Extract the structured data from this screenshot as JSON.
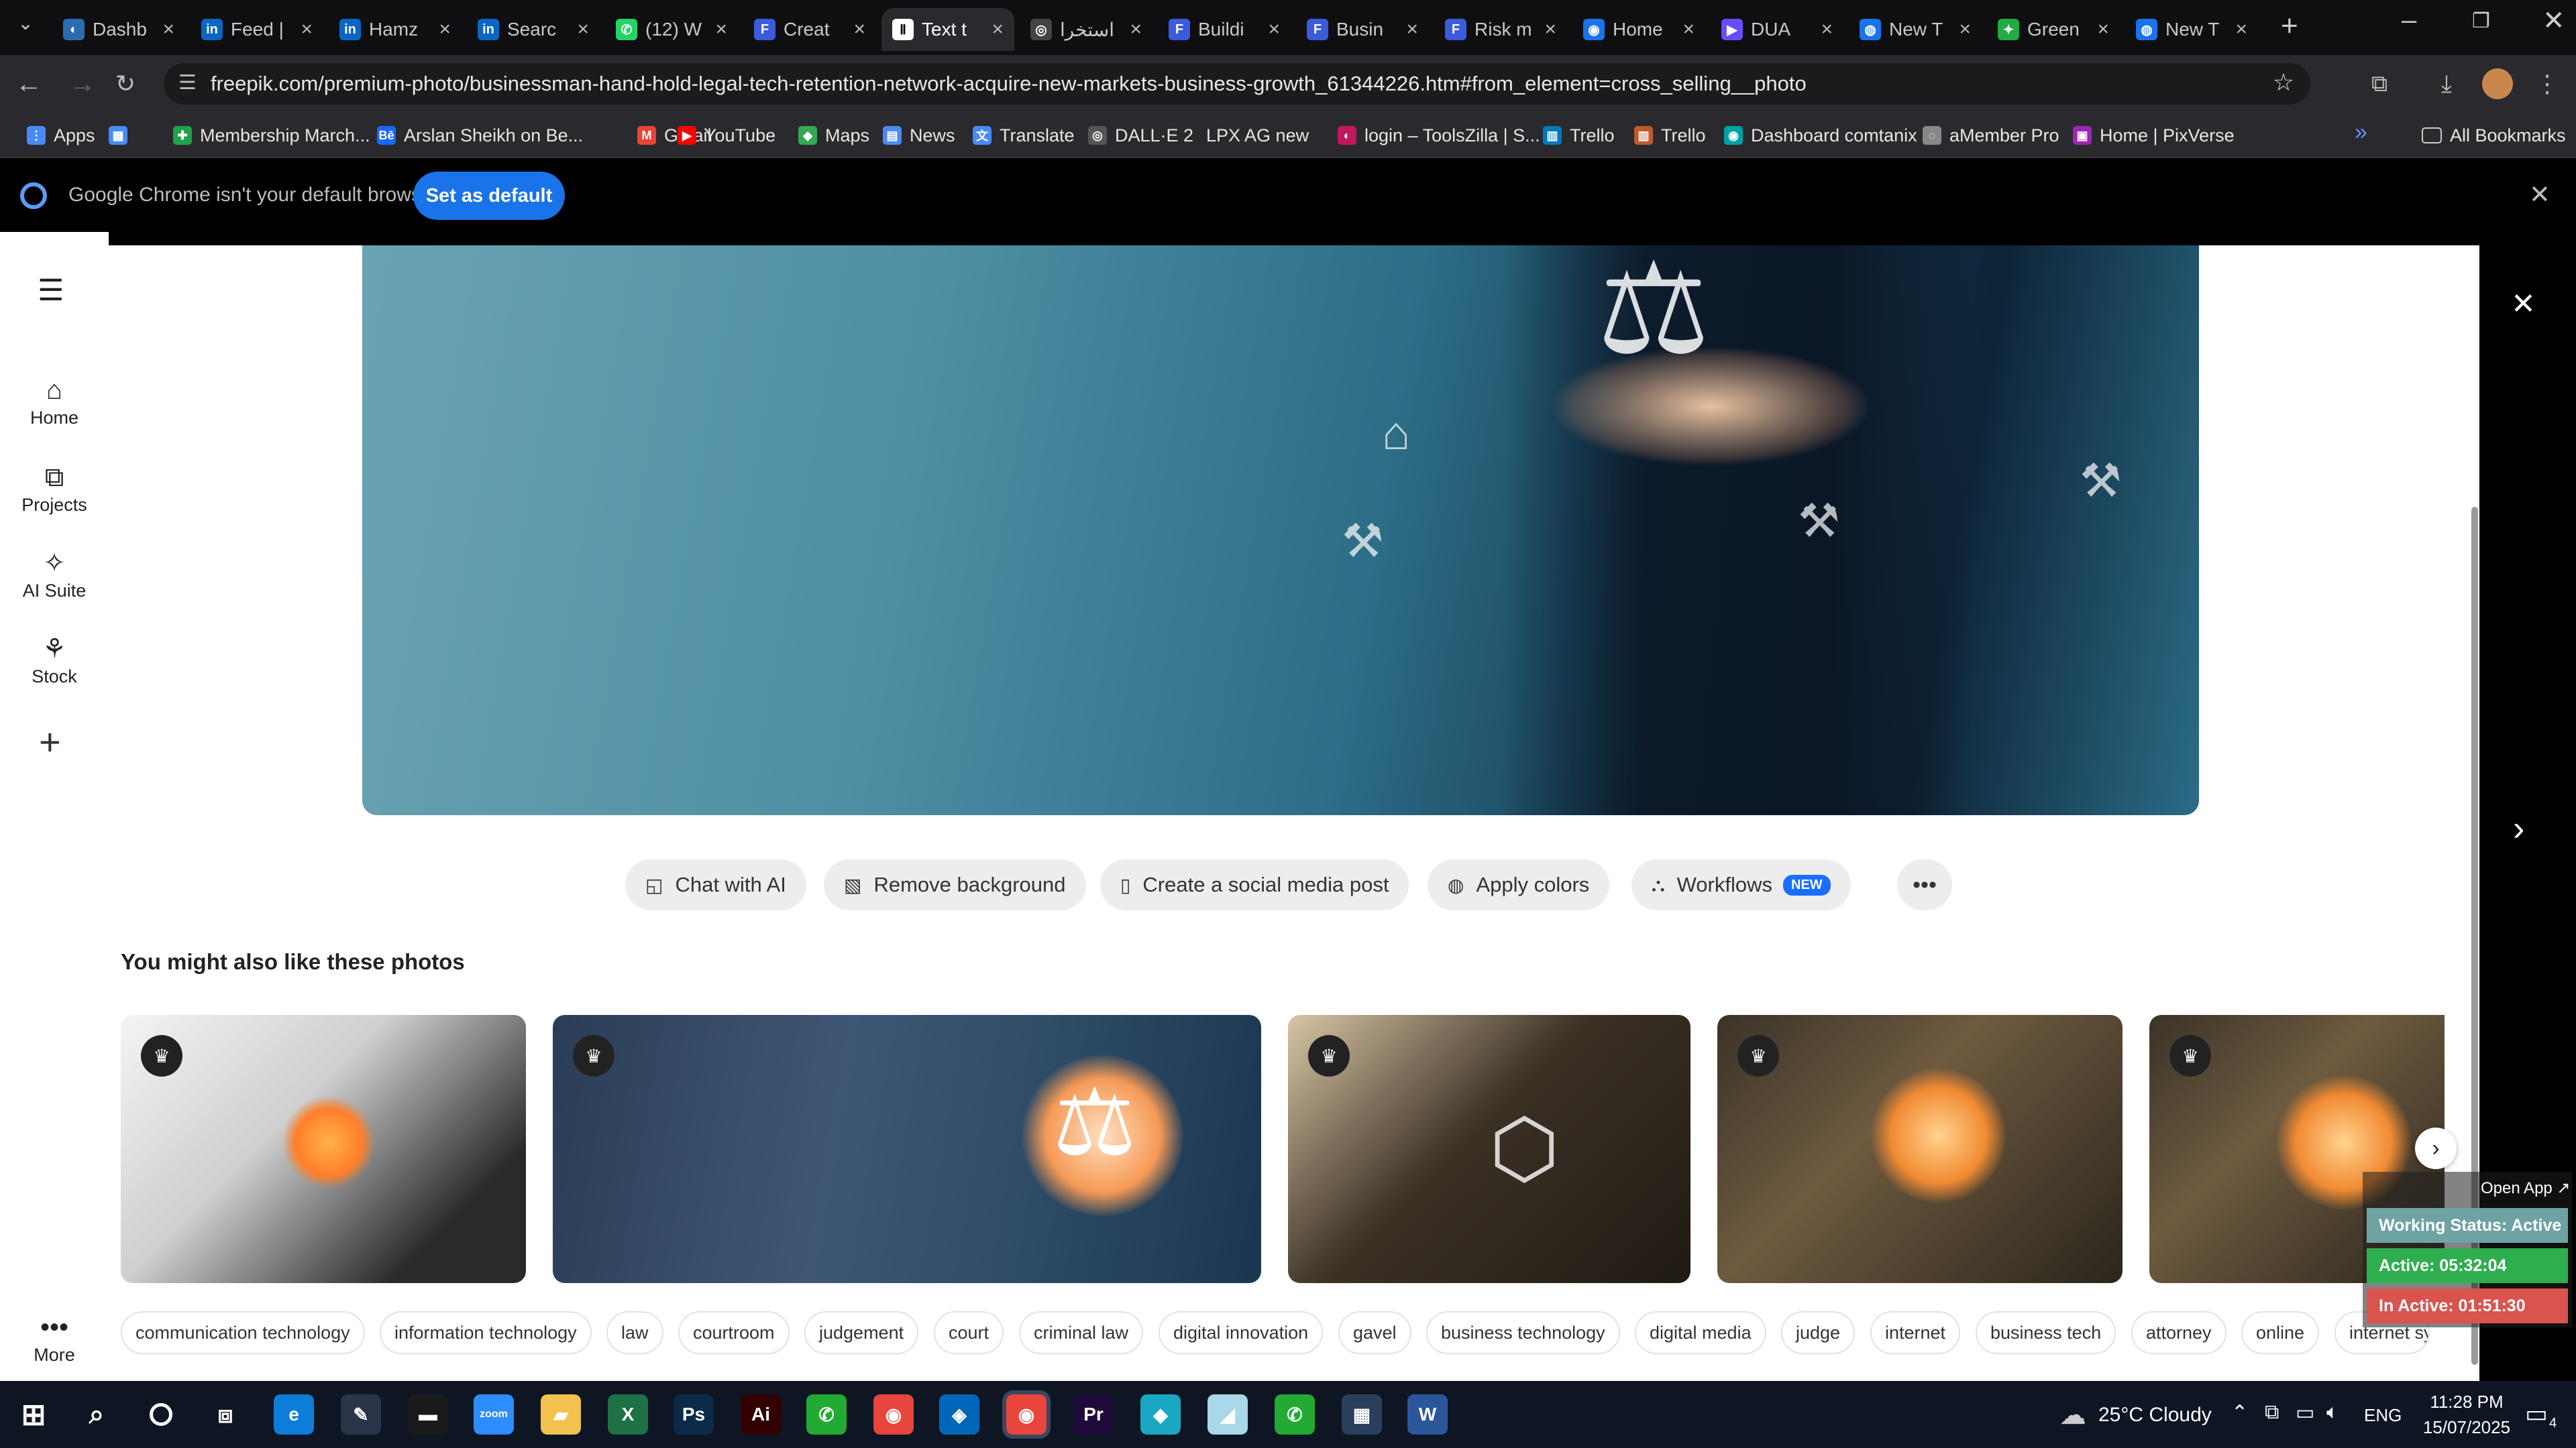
{
  "browser": {
    "tabs": [
      {
        "label": "Dashb",
        "color": "#2b6cb0",
        "glyph": "◐"
      },
      {
        "label": "Feed |",
        "color": "#0a66c2",
        "glyph": "in"
      },
      {
        "label": "Hamz",
        "color": "#0a66c2",
        "glyph": "in"
      },
      {
        "label": "Searc",
        "color": "#0a66c2",
        "glyph": "in"
      },
      {
        "label": "(12) W",
        "color": "#25d366",
        "glyph": "✆"
      },
      {
        "label": "Creat",
        "color": "#3b5bdb",
        "glyph": "F"
      },
      {
        "label": "Text t",
        "color": "#ffffff",
        "glyph": "Ⅱ"
      },
      {
        "label": "استخرا",
        "color": "#444444",
        "glyph": "◎"
      },
      {
        "label": "Buildi",
        "color": "#3b5bdb",
        "glyph": "F"
      },
      {
        "label": "Busin",
        "color": "#3b5bdb",
        "glyph": "F"
      },
      {
        "label": "Risk m",
        "color": "#3b5bdb",
        "glyph": "F"
      },
      {
        "label": "Home",
        "color": "#1a73e8",
        "glyph": "◉"
      },
      {
        "label": "DUA",
        "color": "#6a4cff",
        "glyph": "▶"
      },
      {
        "label": "New T",
        "color": "#1a73e8",
        "glyph": "◍"
      },
      {
        "label": "Green",
        "color": "#22aa44",
        "glyph": "✦"
      },
      {
        "label": "New T",
        "color": "#1a73e8",
        "glyph": "◍"
      }
    ],
    "url": "freepik.com/premium-photo/businessman-hand-hold-legal-tech-retention-network-acquire-new-markets-business-growth_61344226.htm#from_element=cross_selling__photo",
    "bookmarks": [
      {
        "label": "Apps",
        "color": "#4a8af4",
        "glyph": "⋮"
      },
      {
        "label": "",
        "color": "#4a8af4",
        "glyph": "▦"
      },
      {
        "label": "Membership March...",
        "color": "#1ea34a",
        "glyph": "✚"
      },
      {
        "label": "Arslan Sheikh on Be...",
        "color": "#1769ff",
        "glyph": "Bē"
      },
      {
        "label": "Gmail",
        "color": "#ea4335",
        "glyph": "M"
      },
      {
        "label": "YouTube",
        "color": "#ff0000",
        "glyph": "▶"
      },
      {
        "label": "Maps",
        "color": "#34a853",
        "glyph": "◆"
      },
      {
        "label": "News",
        "color": "#4a8af4",
        "glyph": "▤"
      },
      {
        "label": "Translate",
        "color": "#4a8af4",
        "glyph": "文"
      },
      {
        "label": "DALL·E 2",
        "color": "#555555",
        "glyph": "◎"
      },
      {
        "label": "LPX AG new",
        "color": "#2a2a2e",
        "glyph": ""
      },
      {
        "label": "login – ToolsZilla | S...",
        "color": "#c2185b",
        "glyph": "◐"
      },
      {
        "label": "Trello",
        "color": "#0079bf",
        "glyph": "▥"
      },
      {
        "label": "Trello",
        "color": "#c05a2b",
        "glyph": "▥"
      },
      {
        "label": "Dashboard comtanix",
        "color": "#00a3a3",
        "glyph": "◉"
      },
      {
        "label": "aMember Pro",
        "color": "#888888",
        "glyph": "◌"
      },
      {
        "label": "Home | PixVerse",
        "color": "#9c27b0",
        "glyph": "▣"
      }
    ],
    "all_bookmarks": "All Bookmarks",
    "default_notice": "Google Chrome isn't your default browser",
    "set_default": "Set as default"
  },
  "sidebar": {
    "items": [
      {
        "label": "Home",
        "icon": "⌂"
      },
      {
        "label": "Projects",
        "icon": "⧉"
      },
      {
        "label": "AI Suite",
        "icon": "✧"
      },
      {
        "label": "Stock",
        "icon": "⚘"
      }
    ],
    "more_label": "More"
  },
  "actions": [
    {
      "label": "Chat with AI",
      "icon": "◱"
    },
    {
      "label": "Remove background",
      "icon": "▧"
    },
    {
      "label": "Create a social media post",
      "icon": "▯"
    },
    {
      "label": "Apply colors",
      "icon": "◍"
    },
    {
      "label": "Workflows",
      "icon": "⛬",
      "badge": "NEW"
    }
  ],
  "similar": {
    "heading": "You might also like these photos",
    "tags": [
      "communication technology",
      "information technology",
      "law",
      "courtroom",
      "judgement",
      "court",
      "criminal law",
      "digital innovation",
      "gavel",
      "business technology",
      "digital media",
      "judge",
      "internet",
      "business tech",
      "attorney",
      "online",
      "internet symb"
    ]
  },
  "tracker": {
    "open_app": "Open App ↗",
    "working_status": "Working Status: Active",
    "active": "Active: 05:32:04",
    "inactive": "In Active: 01:51:30"
  },
  "taskbar": {
    "weather": "25°C  Cloudy",
    "lang": "ENG",
    "time": "11:28 PM",
    "date": "15/07/2025",
    "notifications": "4",
    "apps": [
      {
        "glyph": "e",
        "color": "#0c7dd8"
      },
      {
        "glyph": "✎",
        "color": "#2a3347"
      },
      {
        "glyph": "▬",
        "color": "#1a1a1a"
      },
      {
        "glyph": "zoom",
        "color": "#2d8cff"
      },
      {
        "glyph": "▰",
        "color": "#f2c14e"
      },
      {
        "glyph": "X",
        "color": "#1e7145"
      },
      {
        "glyph": "Ps",
        "color": "#0a2a48"
      },
      {
        "glyph": "Ai",
        "color": "#330000"
      },
      {
        "glyph": "✆",
        "color": "#22aa33"
      },
      {
        "glyph": "◉",
        "color": "#e8453c"
      },
      {
        "glyph": "◈",
        "color": "#0066b8"
      },
      {
        "glyph": "◉",
        "color": "#e8453c"
      },
      {
        "glyph": "Pr",
        "color": "#1d0a3a"
      },
      {
        "glyph": "◆",
        "color": "#1aa7c4"
      },
      {
        "glyph": "◢",
        "color": "#a9d8e8"
      },
      {
        "glyph": "✆",
        "color": "#22aa33"
      },
      {
        "glyph": "▦",
        "color": "#2a3f5c"
      },
      {
        "glyph": "W",
        "color": "#2b579a"
      }
    ]
  }
}
